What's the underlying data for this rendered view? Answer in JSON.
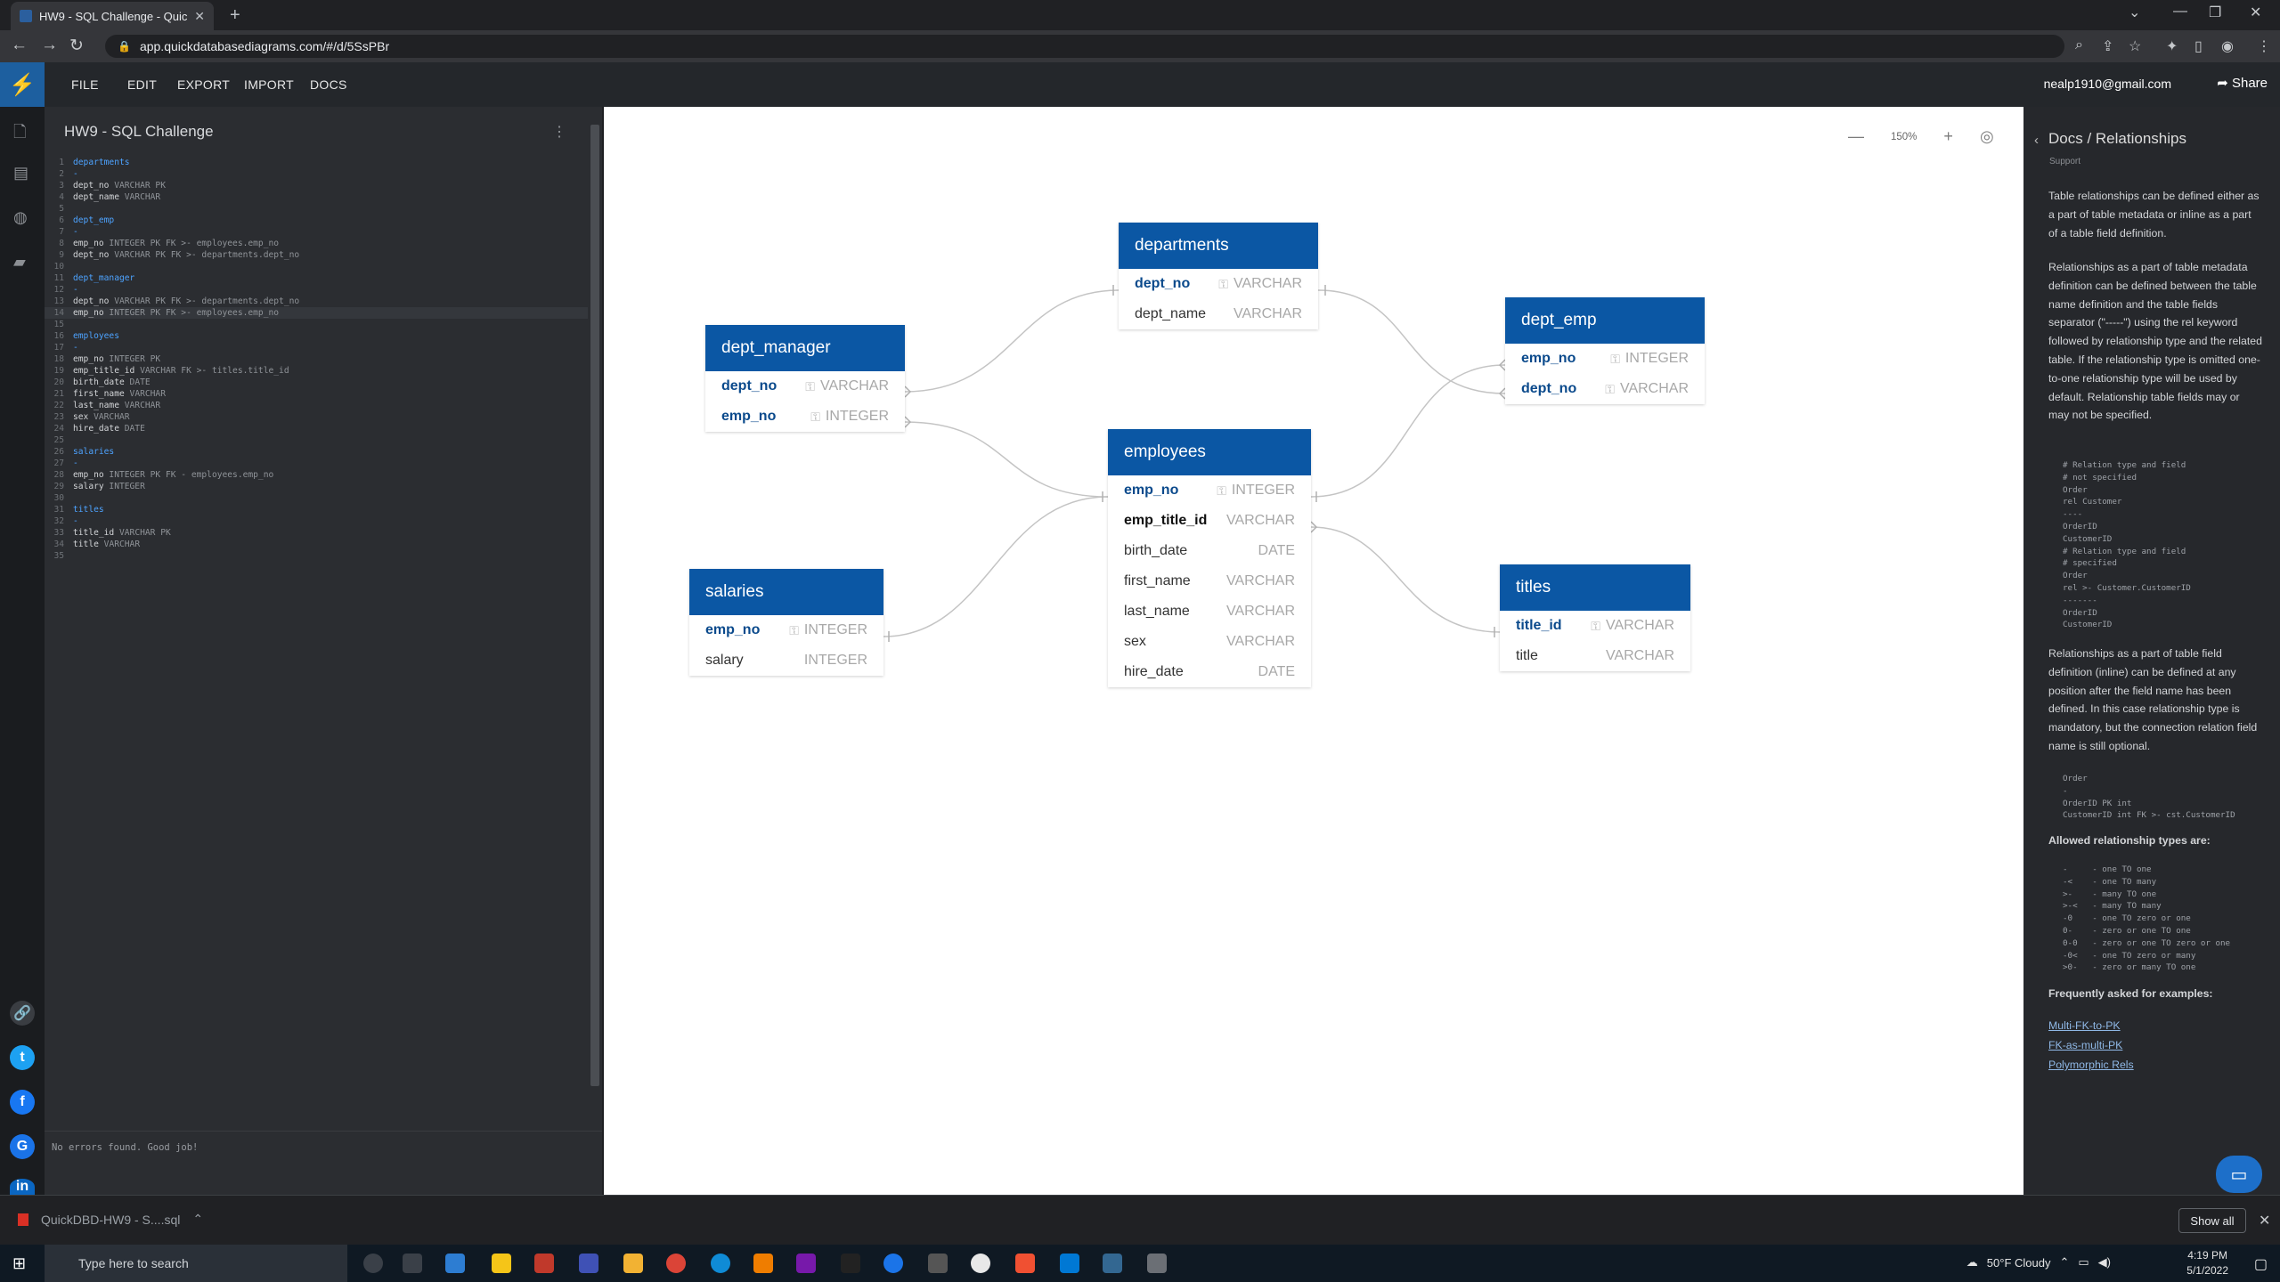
{
  "browser": {
    "tab_title": "HW9 - SQL Challenge - QuickDB",
    "url": "app.quickdatabasediagrams.com/#/d/5SsPBr"
  },
  "app": {
    "menu": [
      "FILE",
      "EDIT",
      "EXPORT",
      "IMPORT",
      "DOCS"
    ],
    "user_email": "nealp1910@gmail.com",
    "share_label": "Share",
    "project_title": "HW9 - SQL Challenge",
    "status_message": "No errors found. Good job!",
    "zoom_level": "150%"
  },
  "code_lines": [
    {
      "n": "1",
      "t": "departments",
      "k": "kw"
    },
    {
      "n": "2",
      "t": "-",
      "k": "kw"
    },
    {
      "n": "3",
      "t": "dept_no",
      "ty": " VARCHAR PK"
    },
    {
      "n": "4",
      "t": "dept_name",
      "ty": " VARCHAR"
    },
    {
      "n": "5",
      "t": ""
    },
    {
      "n": "6",
      "t": "dept_emp",
      "k": "kw"
    },
    {
      "n": "7",
      "t": "-",
      "k": "kw"
    },
    {
      "n": "8",
      "t": "emp_no",
      "ty": " INTEGER PK FK >- employees.emp_no"
    },
    {
      "n": "9",
      "t": "dept_no",
      "ty": " VARCHAR PK FK >- departments.dept_no"
    },
    {
      "n": "10",
      "t": ""
    },
    {
      "n": "11",
      "t": "dept_manager",
      "k": "kw"
    },
    {
      "n": "12",
      "t": "-",
      "k": "kw"
    },
    {
      "n": "13",
      "t": "dept_no",
      "ty": " VARCHAR PK FK >- departments.dept_no"
    },
    {
      "n": "14",
      "t": "emp_no",
      "ty": " INTEGER PK FK >- employees.emp_no",
      "active": true
    },
    {
      "n": "15",
      "t": ""
    },
    {
      "n": "16",
      "t": "employees",
      "k": "kw"
    },
    {
      "n": "17",
      "t": "-",
      "k": "kw"
    },
    {
      "n": "18",
      "t": "emp_no",
      "ty": " INTEGER PK"
    },
    {
      "n": "19",
      "t": "emp_title_id",
      "ty": " VARCHAR FK >- titles.title_id"
    },
    {
      "n": "20",
      "t": "birth_date",
      "ty": " DATE"
    },
    {
      "n": "21",
      "t": "first_name",
      "ty": " VARCHAR"
    },
    {
      "n": "22",
      "t": "last_name",
      "ty": " VARCHAR"
    },
    {
      "n": "23",
      "t": "sex",
      "ty": " VARCHAR"
    },
    {
      "n": "24",
      "t": "hire_date",
      "ty": " DATE"
    },
    {
      "n": "25",
      "t": ""
    },
    {
      "n": "26",
      "t": "salaries",
      "k": "kw"
    },
    {
      "n": "27",
      "t": "-",
      "k": "kw"
    },
    {
      "n": "28",
      "t": "emp_no",
      "ty": " INTEGER PK FK - employees.emp_no"
    },
    {
      "n": "29",
      "t": "salary",
      "ty": " INTEGER"
    },
    {
      "n": "30",
      "t": ""
    },
    {
      "n": "31",
      "t": "titles",
      "k": "kw"
    },
    {
      "n": "32",
      "t": "-",
      "k": "kw"
    },
    {
      "n": "33",
      "t": "title_id",
      "ty": " VARCHAR PK"
    },
    {
      "n": "34",
      "t": "title",
      "ty": " VARCHAR"
    },
    {
      "n": "35",
      "t": ""
    }
  ],
  "tables": {
    "departments": {
      "name": "departments",
      "fields": [
        {
          "name": "dept_no",
          "type": "VARCHAR",
          "pk": true
        },
        {
          "name": "dept_name",
          "type": "VARCHAR"
        }
      ]
    },
    "dept_emp": {
      "name": "dept_emp",
      "fields": [
        {
          "name": "emp_no",
          "type": "INTEGER",
          "pk": true
        },
        {
          "name": "dept_no",
          "type": "VARCHAR",
          "pk": true
        }
      ]
    },
    "dept_manager": {
      "name": "dept_manager",
      "fields": [
        {
          "name": "dept_no",
          "type": "VARCHAR",
          "pk": true
        },
        {
          "name": "emp_no",
          "type": "INTEGER",
          "pk": true
        }
      ]
    },
    "employees": {
      "name": "employees",
      "fields": [
        {
          "name": "emp_no",
          "type": "INTEGER",
          "pk": true
        },
        {
          "name": "emp_title_id",
          "type": "VARCHAR",
          "fk": true
        },
        {
          "name": "birth_date",
          "type": "DATE"
        },
        {
          "name": "first_name",
          "type": "VARCHAR"
        },
        {
          "name": "last_name",
          "type": "VARCHAR"
        },
        {
          "name": "sex",
          "type": "VARCHAR"
        },
        {
          "name": "hire_date",
          "type": "DATE"
        }
      ]
    },
    "salaries": {
      "name": "salaries",
      "fields": [
        {
          "name": "emp_no",
          "type": "INTEGER",
          "pk": true
        },
        {
          "name": "salary",
          "type": "INTEGER"
        }
      ]
    },
    "titles": {
      "name": "titles",
      "fields": [
        {
          "name": "title_id",
          "type": "VARCHAR",
          "pk": true
        },
        {
          "name": "title",
          "type": "VARCHAR"
        }
      ]
    }
  },
  "docs": {
    "title": "Docs / Relationships",
    "subtitle": "Support",
    "p1": "Table relationships can be defined either as a part of table metadata or inline as a part of a table field definition.",
    "p2": "Relationships as a part of table metadata definition can be defined between the table name definition and the table fields separator (\"-----\") using the rel keyword followed by relationship type and the related table. If the relationship type is omitted one-to-one relationship type will be used by default. Relationship table fields may or may not be specified.",
    "code1": "# Relation type and field\n# not specified\nOrder\nrel Customer\n----\nOrderID\nCustomerID\n# Relation type and field\n# specified\nOrder\nrel >- Customer.CustomerID\n-------\nOrderID\nCustomerID",
    "p3": "Relationships as a part of table field definition (inline) can be defined at any position after the field name has been defined. In this case relationship type is mandatory, but the connection relation field name is still optional.",
    "code2": "Order\n-\nOrderID PK int\nCustomerID int FK >- cst.CustomerID",
    "p4": "Allowed relationship types are:",
    "code3": "-     - one TO one\n-<    - one TO many\n>-    - many TO one\n>-<   - many TO many\n-0    - one TO zero or one\n0-    - zero or one TO one\n0-0   - zero or one TO zero or one\n-0<   - one TO zero or many\n>0-   - zero or many TO one",
    "p5": "Frequently asked for examples:",
    "links": [
      "Multi-FK-to-PK",
      "FK-as-multi-PK",
      "Polymorphic Rels"
    ]
  },
  "downloads": {
    "file": "QuickDBD-HW9 - S....sql",
    "show_all": "Show all"
  },
  "taskbar": {
    "search_placeholder": "Type here to search",
    "weather": "50°F  Cloudy",
    "time": "4:19 PM",
    "date": "5/1/2022"
  }
}
